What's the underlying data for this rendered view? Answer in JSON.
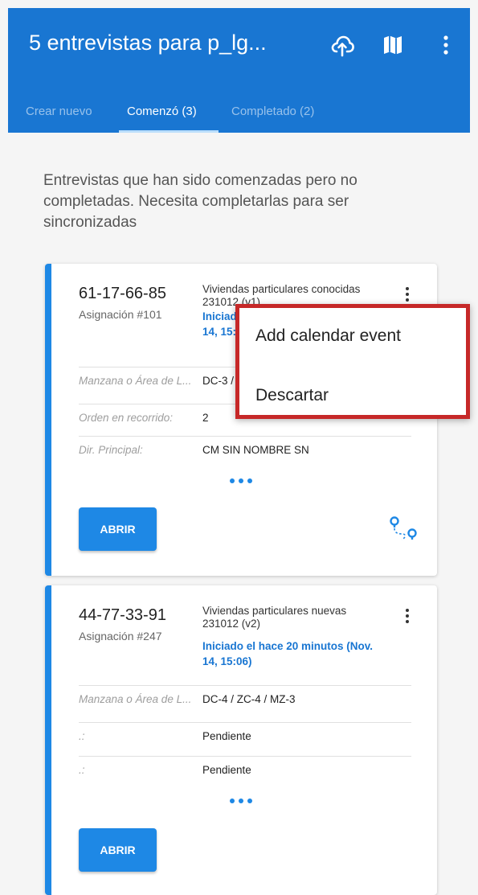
{
  "appbar": {
    "title": "5 entrevistas para p_lg...",
    "icons": [
      "cloud-sync-icon",
      "map-icon",
      "more-vert-icon"
    ]
  },
  "tabs": [
    {
      "label": "Crear nuevo",
      "active": false
    },
    {
      "label": "Comenzó (3)",
      "active": true
    },
    {
      "label": "Completado (2)",
      "active": false
    }
  ],
  "intro_text": "Entrevistas que han sido comenzadas pero no completadas. Necesita completarlas para ser sincronizadas",
  "cards": [
    {
      "code": "61-17-66-85",
      "assignment": "Asignación #101",
      "survey": "Viviendas particulares conocidas 231012 (v1)",
      "started": "Iniciado el hace 20 minutos (Nov. 14, 15:06)",
      "fields": [
        {
          "label": "Manzana o Área de L...",
          "value": "DC-3 / ZC-4 / MZ-3"
        },
        {
          "label": "Orden en recorrido:",
          "value": "2"
        },
        {
          "label": "Dir. Principal:",
          "value": "CM SIN NOMBRE SN"
        }
      ],
      "open_label": "ABRIR"
    },
    {
      "code": "44-77-33-91",
      "assignment": "Asignación #247",
      "survey": "Viviendas particulares nuevas 231012 (v2)",
      "started": "Iniciado el hace 20 minutos (Nov. 14, 15:06)",
      "fields": [
        {
          "label": "Manzana o Área de L...",
          "value": "DC-4 / ZC-4 / MZ-3"
        },
        {
          "label": ".:",
          "value": "Pendiente"
        },
        {
          "label": ".:",
          "value": "Pendiente"
        }
      ],
      "open_label": "ABRIR"
    }
  ],
  "popup_menu": {
    "items": [
      "Add calendar event",
      "Descartar"
    ],
    "highlight_color": "#c62828"
  },
  "colors": {
    "primary": "#1976d2",
    "accent": "#1e88e5"
  }
}
